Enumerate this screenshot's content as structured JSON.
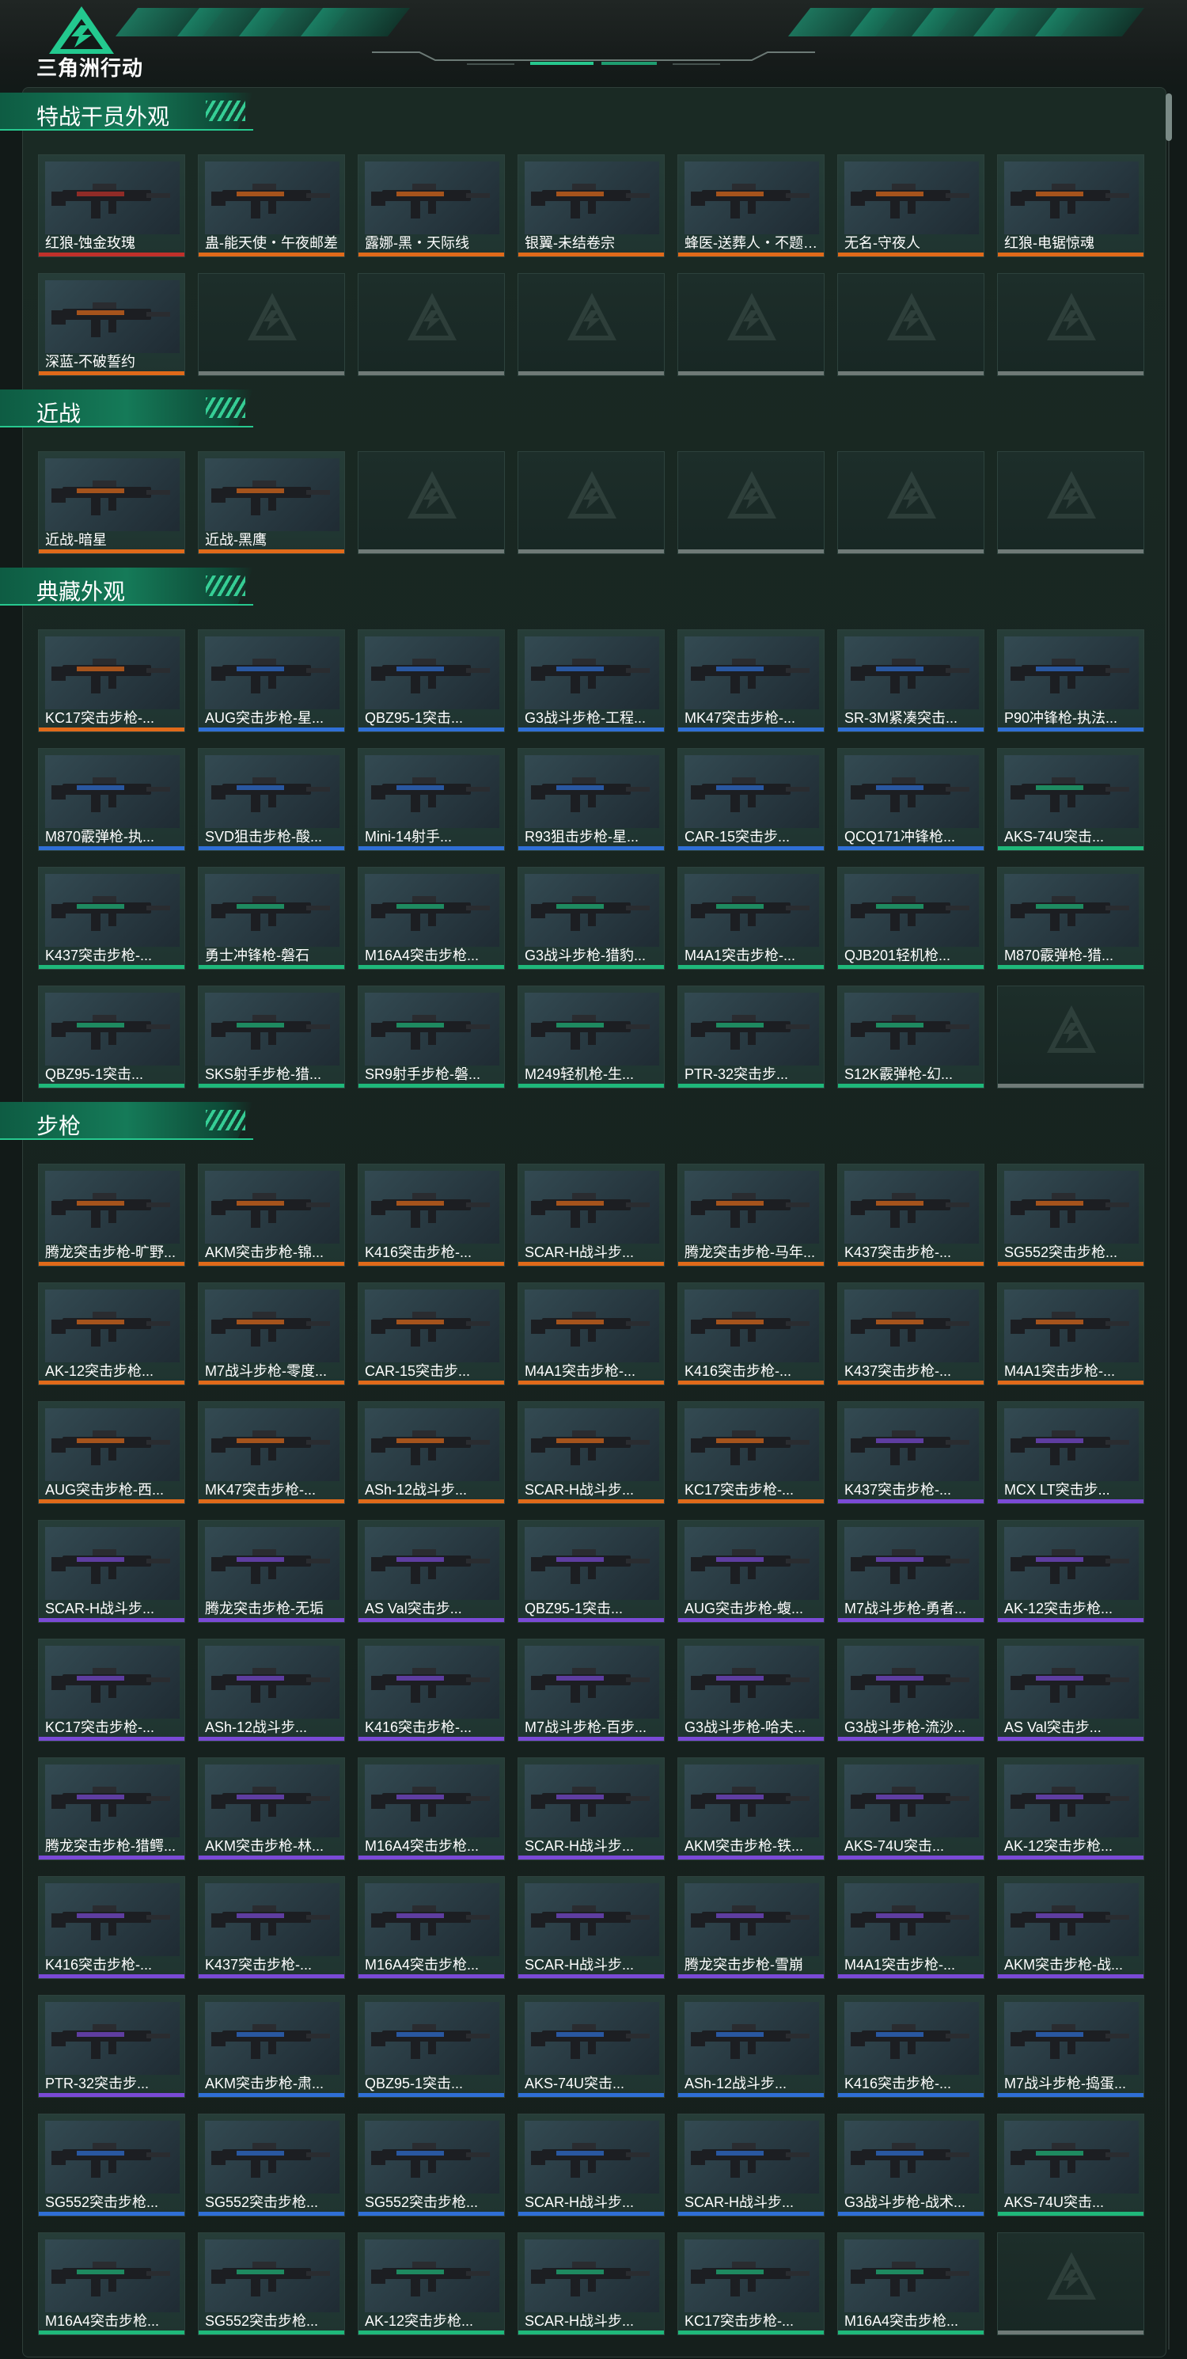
{
  "app": {
    "logo_text": "三角洲行动"
  },
  "colors": {
    "orange": "#e06a1a",
    "purple": "#7a4ad6",
    "blue": "#2f6fd6",
    "green": "#1fb87a",
    "red": "#c0302a",
    "accent": "#27c88f"
  },
  "sections": [
    {
      "title": "特战干员外观",
      "items": [
        {
          "label": "红狼-蚀金玫瑰",
          "rarity": "red"
        },
        {
          "label": "蛊-能天使・午夜邮差",
          "rarity": "orange"
        },
        {
          "label": "露娜-黑・天际线",
          "rarity": "orange"
        },
        {
          "label": "银翼-未结卷宗",
          "rarity": "orange"
        },
        {
          "label": "蜂医-送葬人・不题写的碑文",
          "rarity": "orange"
        },
        {
          "label": "无名-守夜人",
          "rarity": "orange"
        },
        {
          "label": "红狼-电锯惊魂",
          "rarity": "orange"
        },
        {
          "label": "深蓝-不破誓约",
          "rarity": "orange"
        },
        {
          "label": "",
          "rarity": "empty"
        },
        {
          "label": "",
          "rarity": "empty"
        },
        {
          "label": "",
          "rarity": "empty"
        },
        {
          "label": "",
          "rarity": "empty"
        },
        {
          "label": "",
          "rarity": "empty"
        },
        {
          "label": "",
          "rarity": "empty"
        }
      ]
    },
    {
      "title": "近战",
      "items": [
        {
          "label": "近战-暗星",
          "rarity": "orange"
        },
        {
          "label": "近战-黑鹰",
          "rarity": "orange"
        },
        {
          "label": "",
          "rarity": "empty"
        },
        {
          "label": "",
          "rarity": "empty"
        },
        {
          "label": "",
          "rarity": "empty"
        },
        {
          "label": "",
          "rarity": "empty"
        },
        {
          "label": "",
          "rarity": "empty"
        }
      ]
    },
    {
      "title": "典藏外观",
      "items": [
        {
          "label": "KC17突击步枪-...",
          "rarity": "orange"
        },
        {
          "label": "AUG突击步枪-星...",
          "rarity": "blue"
        },
        {
          "label": "QBZ95-1突击...",
          "rarity": "blue"
        },
        {
          "label": "G3战斗步枪-工程...",
          "rarity": "blue"
        },
        {
          "label": "MK47突击步枪-...",
          "rarity": "blue"
        },
        {
          "label": "SR-3M紧凑突击...",
          "rarity": "blue"
        },
        {
          "label": "P90冲锋枪-执法...",
          "rarity": "blue"
        },
        {
          "label": "M870霰弹枪-执...",
          "rarity": "blue"
        },
        {
          "label": "SVD狙击步枪-酸...",
          "rarity": "blue"
        },
        {
          "label": "Mini-14射手...",
          "rarity": "blue"
        },
        {
          "label": "R93狙击步枪-星...",
          "rarity": "blue"
        },
        {
          "label": "CAR-15突击步...",
          "rarity": "blue"
        },
        {
          "label": "QCQ171冲锋枪...",
          "rarity": "blue"
        },
        {
          "label": "AKS-74U突击...",
          "rarity": "green"
        },
        {
          "label": "K437突击步枪-...",
          "rarity": "green"
        },
        {
          "label": "勇士冲锋枪-磐石",
          "rarity": "green"
        },
        {
          "label": "M16A4突击步枪...",
          "rarity": "green"
        },
        {
          "label": "G3战斗步枪-猎豹...",
          "rarity": "green"
        },
        {
          "label": "M4A1突击步枪-...",
          "rarity": "green"
        },
        {
          "label": "QJB201轻机枪...",
          "rarity": "green"
        },
        {
          "label": "M870霰弹枪-猎...",
          "rarity": "green"
        },
        {
          "label": "QBZ95-1突击...",
          "rarity": "green"
        },
        {
          "label": "SKS射手步枪-猎...",
          "rarity": "green"
        },
        {
          "label": "SR9射手步枪-磐...",
          "rarity": "green"
        },
        {
          "label": "M249轻机枪-生...",
          "rarity": "green"
        },
        {
          "label": "PTR-32突击步...",
          "rarity": "green"
        },
        {
          "label": "S12K霰弹枪-幻...",
          "rarity": "green"
        },
        {
          "label": "",
          "rarity": "empty"
        }
      ]
    },
    {
      "title": "步枪",
      "items": [
        {
          "label": "腾龙突击步枪-旷野...",
          "rarity": "orange"
        },
        {
          "label": "AKM突击步枪-锦...",
          "rarity": "orange"
        },
        {
          "label": "K416突击步枪-...",
          "rarity": "orange"
        },
        {
          "label": "SCAR-H战斗步...",
          "rarity": "orange"
        },
        {
          "label": "腾龙突击步枪-马年...",
          "rarity": "orange"
        },
        {
          "label": "K437突击步枪-...",
          "rarity": "orange"
        },
        {
          "label": "SG552突击步枪...",
          "rarity": "orange"
        },
        {
          "label": "AK-12突击步枪...",
          "rarity": "orange"
        },
        {
          "label": "M7战斗步枪-零度...",
          "rarity": "orange"
        },
        {
          "label": "CAR-15突击步...",
          "rarity": "orange"
        },
        {
          "label": "M4A1突击步枪-...",
          "rarity": "orange"
        },
        {
          "label": "K416突击步枪-...",
          "rarity": "orange"
        },
        {
          "label": "K437突击步枪-...",
          "rarity": "orange"
        },
        {
          "label": "M4A1突击步枪-...",
          "rarity": "orange"
        },
        {
          "label": "AUG突击步枪-西...",
          "rarity": "orange"
        },
        {
          "label": "MK47突击步枪-...",
          "rarity": "orange"
        },
        {
          "label": "ASh-12战斗步...",
          "rarity": "orange"
        },
        {
          "label": "SCAR-H战斗步...",
          "rarity": "orange"
        },
        {
          "label": "KC17突击步枪-...",
          "rarity": "orange"
        },
        {
          "label": "K437突击步枪-...",
          "rarity": "purple"
        },
        {
          "label": "MCX LT突击步...",
          "rarity": "purple"
        },
        {
          "label": "SCAR-H战斗步...",
          "rarity": "purple"
        },
        {
          "label": "腾龙突击步枪-无垢",
          "rarity": "purple"
        },
        {
          "label": "AS Val突击步...",
          "rarity": "purple"
        },
        {
          "label": "QBZ95-1突击...",
          "rarity": "purple"
        },
        {
          "label": "AUG突击步枪-蝮...",
          "rarity": "purple"
        },
        {
          "label": "M7战斗步枪-勇者...",
          "rarity": "purple"
        },
        {
          "label": "AK-12突击步枪...",
          "rarity": "purple"
        },
        {
          "label": "KC17突击步枪-...",
          "rarity": "purple"
        },
        {
          "label": "ASh-12战斗步...",
          "rarity": "purple"
        },
        {
          "label": "K416突击步枪-...",
          "rarity": "purple"
        },
        {
          "label": "M7战斗步枪-百步...",
          "rarity": "purple"
        },
        {
          "label": "G3战斗步枪-哈夫...",
          "rarity": "purple"
        },
        {
          "label": "G3战斗步枪-流沙...",
          "rarity": "purple"
        },
        {
          "label": "AS Val突击步...",
          "rarity": "purple"
        },
        {
          "label": "腾龙突击步枪-猎鳄...",
          "rarity": "purple"
        },
        {
          "label": "AKM突击步枪-林...",
          "rarity": "purple"
        },
        {
          "label": "M16A4突击步枪...",
          "rarity": "purple"
        },
        {
          "label": "SCAR-H战斗步...",
          "rarity": "purple"
        },
        {
          "label": "AKM突击步枪-铁...",
          "rarity": "purple"
        },
        {
          "label": "AKS-74U突击...",
          "rarity": "purple"
        },
        {
          "label": "AK-12突击步枪...",
          "rarity": "purple"
        },
        {
          "label": "K416突击步枪-...",
          "rarity": "purple"
        },
        {
          "label": "K437突击步枪-...",
          "rarity": "purple"
        },
        {
          "label": "M16A4突击步枪...",
          "rarity": "purple"
        },
        {
          "label": "SCAR-H战斗步...",
          "rarity": "purple"
        },
        {
          "label": "腾龙突击步枪-雪崩",
          "rarity": "purple"
        },
        {
          "label": "M4A1突击步枪-...",
          "rarity": "purple"
        },
        {
          "label": "AKM突击步枪-战...",
          "rarity": "purple"
        },
        {
          "label": "PTR-32突击步...",
          "rarity": "purple"
        },
        {
          "label": "AKM突击步枪-肃...",
          "rarity": "blue"
        },
        {
          "label": "QBZ95-1突击...",
          "rarity": "blue"
        },
        {
          "label": "AKS-74U突击...",
          "rarity": "blue"
        },
        {
          "label": "ASh-12战斗步...",
          "rarity": "blue"
        },
        {
          "label": "K416突击步枪-...",
          "rarity": "blue"
        },
        {
          "label": "M7战斗步枪-捣蛋...",
          "rarity": "blue"
        },
        {
          "label": "SG552突击步枪...",
          "rarity": "blue"
        },
        {
          "label": "SG552突击步枪...",
          "rarity": "blue"
        },
        {
          "label": "SG552突击步枪...",
          "rarity": "blue"
        },
        {
          "label": "SCAR-H战斗步...",
          "rarity": "blue"
        },
        {
          "label": "SCAR-H战斗步...",
          "rarity": "blue"
        },
        {
          "label": "G3战斗步枪-战术...",
          "rarity": "blue"
        },
        {
          "label": "AKS-74U突击...",
          "rarity": "green"
        },
        {
          "label": "M16A4突击步枪...",
          "rarity": "green"
        },
        {
          "label": "SG552突击步枪...",
          "rarity": "green"
        },
        {
          "label": "AK-12突击步枪...",
          "rarity": "green"
        },
        {
          "label": "SCAR-H战斗步...",
          "rarity": "green"
        },
        {
          "label": "KC17突击步枪-...",
          "rarity": "green"
        },
        {
          "label": "M16A4突击步枪...",
          "rarity": "green"
        },
        {
          "label": "",
          "rarity": "empty"
        }
      ]
    }
  ]
}
